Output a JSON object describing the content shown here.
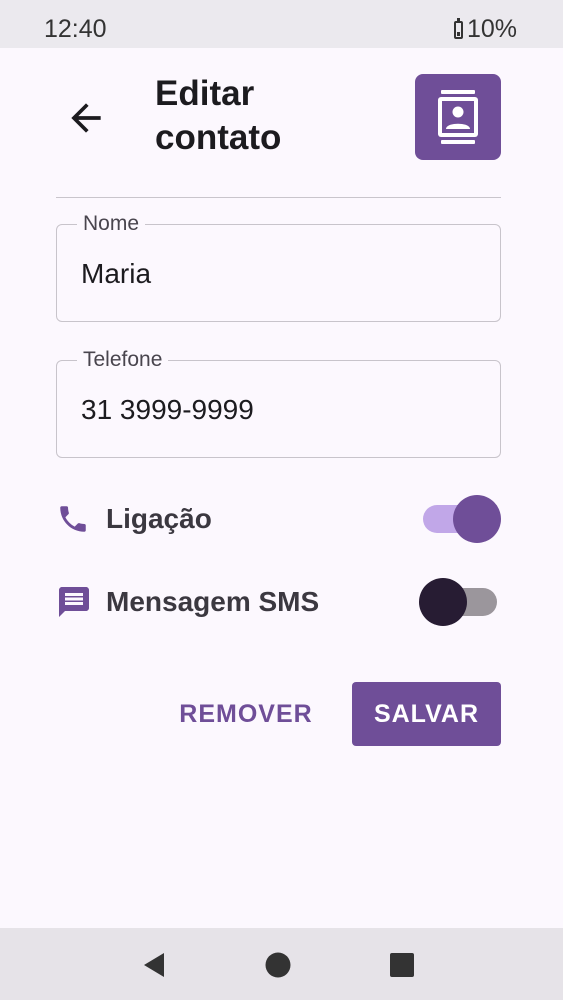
{
  "status_bar": {
    "time": "12:40",
    "battery": "10%"
  },
  "header": {
    "title": "Editar contato"
  },
  "form": {
    "name": {
      "label": "Nome",
      "value": "Maria"
    },
    "phone": {
      "label": "Telefone",
      "value": "31 3999-9999"
    }
  },
  "options": {
    "call": {
      "label": "Ligação",
      "enabled": true
    },
    "sms": {
      "label": "Mensagem SMS",
      "enabled": false
    }
  },
  "actions": {
    "remove_label": "REMOVER",
    "save_label": "SALVAR"
  },
  "colors": {
    "accent": "#6f4e98",
    "background": "#fcf8fe",
    "switch_track_on": "#c1a7e8"
  },
  "icons": {
    "back": "arrow-back-icon",
    "badge": "contact-card-icon",
    "call": "phone-icon",
    "sms": "message-icon",
    "nav": [
      "back-triangle-icon",
      "home-circle-icon",
      "recents-square-icon"
    ]
  }
}
